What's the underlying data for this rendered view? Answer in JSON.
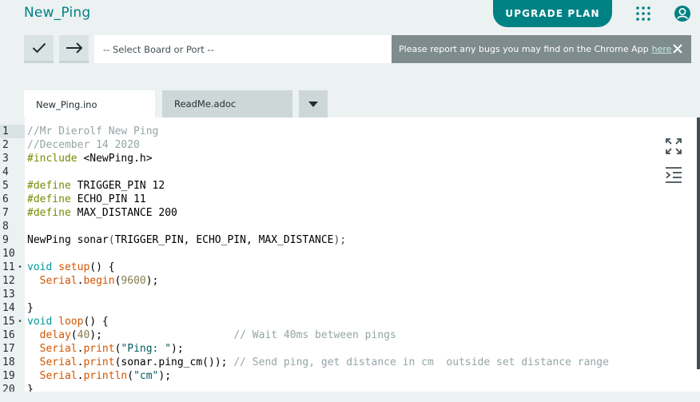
{
  "header": {
    "sketch_title": "New_Ping",
    "upgrade_label": "UPGRADE PLAN"
  },
  "toolbar": {
    "board_placeholder": "-- Select Board or Port --",
    "notice_text": "Please report any bugs you may find on the Chrome App",
    "notice_link": "here"
  },
  "tabs": [
    {
      "label": "New_Ping.ino"
    },
    {
      "label": "ReadMe.adoc"
    }
  ],
  "editor": {
    "line_numbers": [
      "1",
      "2",
      "3",
      "4",
      "5",
      "6",
      "7",
      "8",
      "9",
      "10",
      "11",
      "12",
      "13",
      "14",
      "15",
      "16",
      "17",
      "18",
      "19",
      "20"
    ],
    "fold_markers": [
      "11",
      "15"
    ]
  },
  "colors": {
    "accent": "#008184",
    "keyword": "#00979c",
    "function": "#d35400",
    "comment": "#95a5a6",
    "preprocessor": "#728e00"
  },
  "code": {
    "l1": "//Mr Dierolf New Ping",
    "l2": "//December 14 2020",
    "l3_kw": "#include",
    "l3_rest": " <NewPing.h>",
    "l5_kw": "#define",
    "l5_rest": " TRIGGER_PIN 12",
    "l6_kw": "#define",
    "l6_rest": " ECHO_PIN 11",
    "l7_kw": "#define",
    "l7_rest": " MAX_DISTANCE 200",
    "l9_a": "NewPing sonar",
    "l9_b": "(",
    "l9_c": "TRIGGER_PIN, ECHO_PIN, MAX_DISTANCE",
    "l9_d": ");",
    "l11_kw": "void",
    "l11_fn": "setup",
    "l11_rest": "() {",
    "l12_obj": "Serial",
    "l12_dot": ".",
    "l12_fn": "begin",
    "l12_p1": "(",
    "l12_num": "9600",
    "l12_p2": ");",
    "l14": "}",
    "l15_kw": "void",
    "l15_fn": "loop",
    "l15_rest": "() {",
    "l16_fn": "delay",
    "l16_p1": "(",
    "l16_num": "40",
    "l16_p2": ");",
    "l16_cm": "// Wait 40ms between pings",
    "l17_obj": "Serial",
    "l17_dot": ".",
    "l17_fn": "print",
    "l17_p1": "(",
    "l17_str": "\"Ping: \"",
    "l17_p2": ");",
    "l18_obj": "Serial",
    "l18_dot": ".",
    "l18_fn": "print",
    "l18_p1": "(sonar.ping_cm());",
    "l18_cm": "// Send ping, get distance in cm  outside set distance range",
    "l19_obj": "Serial",
    "l19_dot": ".",
    "l19_fn": "println",
    "l19_p1": "(",
    "l19_str": "\"cm\"",
    "l19_p2": ");",
    "l20": "}"
  }
}
